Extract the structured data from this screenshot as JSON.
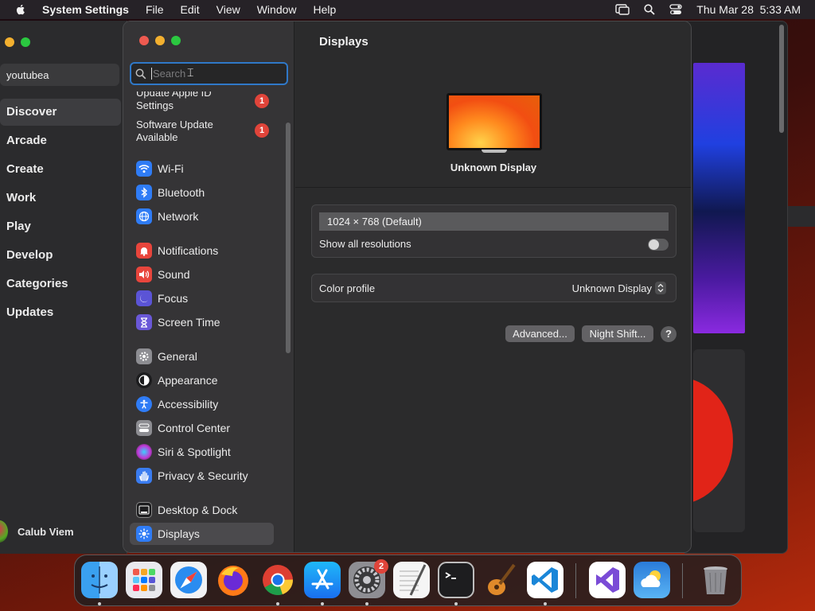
{
  "menubar": {
    "app_name": "System Settings",
    "items": [
      "File",
      "Edit",
      "View",
      "Window",
      "Help"
    ],
    "clock": "Thu Mar 28  5:33 AM"
  },
  "appstore": {
    "search_value": "youtubea",
    "nav": [
      "Discover",
      "Arcade",
      "Create",
      "Work",
      "Play",
      "Develop",
      "Categories",
      "Updates"
    ],
    "active": "Discover",
    "user_name": "Calub Viem"
  },
  "settings": {
    "search_placeholder": "Search",
    "notices": [
      {
        "label": "Update Apple ID Settings",
        "badge": "1"
      },
      {
        "label": "Software Update Available",
        "badge": "1"
      }
    ],
    "sidebar_items": [
      {
        "label": "Wi-Fi",
        "icon": "wifi-icon",
        "color": "#2f7cf6"
      },
      {
        "label": "Bluetooth",
        "icon": "bluetooth-icon",
        "color": "#2f7cf6"
      },
      {
        "label": "Network",
        "icon": "globe-icon",
        "color": "#2f7cf6"
      },
      {
        "label": "Notifications",
        "icon": "bell-icon",
        "color": "#e8453c"
      },
      {
        "label": "Sound",
        "icon": "speaker-icon",
        "color": "#e8453c"
      },
      {
        "label": "Focus",
        "icon": "moon-icon",
        "color": "#5b54d6"
      },
      {
        "label": "Screen Time",
        "icon": "hourglass-icon",
        "color": "#6a58d8"
      },
      {
        "label": "General",
        "icon": "gear-icon",
        "color": "#8d8d92"
      },
      {
        "label": "Appearance",
        "icon": "appearance-icon",
        "color": "#1c1c1e"
      },
      {
        "label": "Accessibility",
        "icon": "accessibility-icon",
        "color": "#2f7cf6"
      },
      {
        "label": "Control Center",
        "icon": "control-center-icon",
        "color": "#8d8d92"
      },
      {
        "label": "Siri & Spotlight",
        "icon": "siri-icon",
        "color": "#c03ad6"
      },
      {
        "label": "Privacy & Security",
        "icon": "hand-icon",
        "color": "#3a7cf0"
      },
      {
        "label": "Desktop & Dock",
        "icon": "dock-icon",
        "color": "#1c1c1e"
      },
      {
        "label": "Displays",
        "icon": "brightness-icon",
        "color": "#2f7cf6"
      }
    ],
    "selected_item": "Displays",
    "detail": {
      "title": "Displays",
      "display_name": "Unknown Display",
      "resolution": "1024 × 768 (Default)",
      "show_all_label": "Show all resolutions",
      "show_all_on": false,
      "color_profile_label": "Color profile",
      "color_profile_value": "Unknown Display",
      "advanced_label": "Advanced...",
      "night_shift_label": "Night Shift...",
      "help_label": "?"
    }
  },
  "dock": {
    "apps": [
      "Finder",
      "Launchpad",
      "Safari",
      "Firefox",
      "Chrome",
      "App Store",
      "System Settings",
      "TextEdit",
      "Terminal",
      "GarageBand",
      "Visual Studio Code",
      "Visual Studio",
      "Weather",
      "Trash"
    ],
    "settings_badge": "2"
  }
}
